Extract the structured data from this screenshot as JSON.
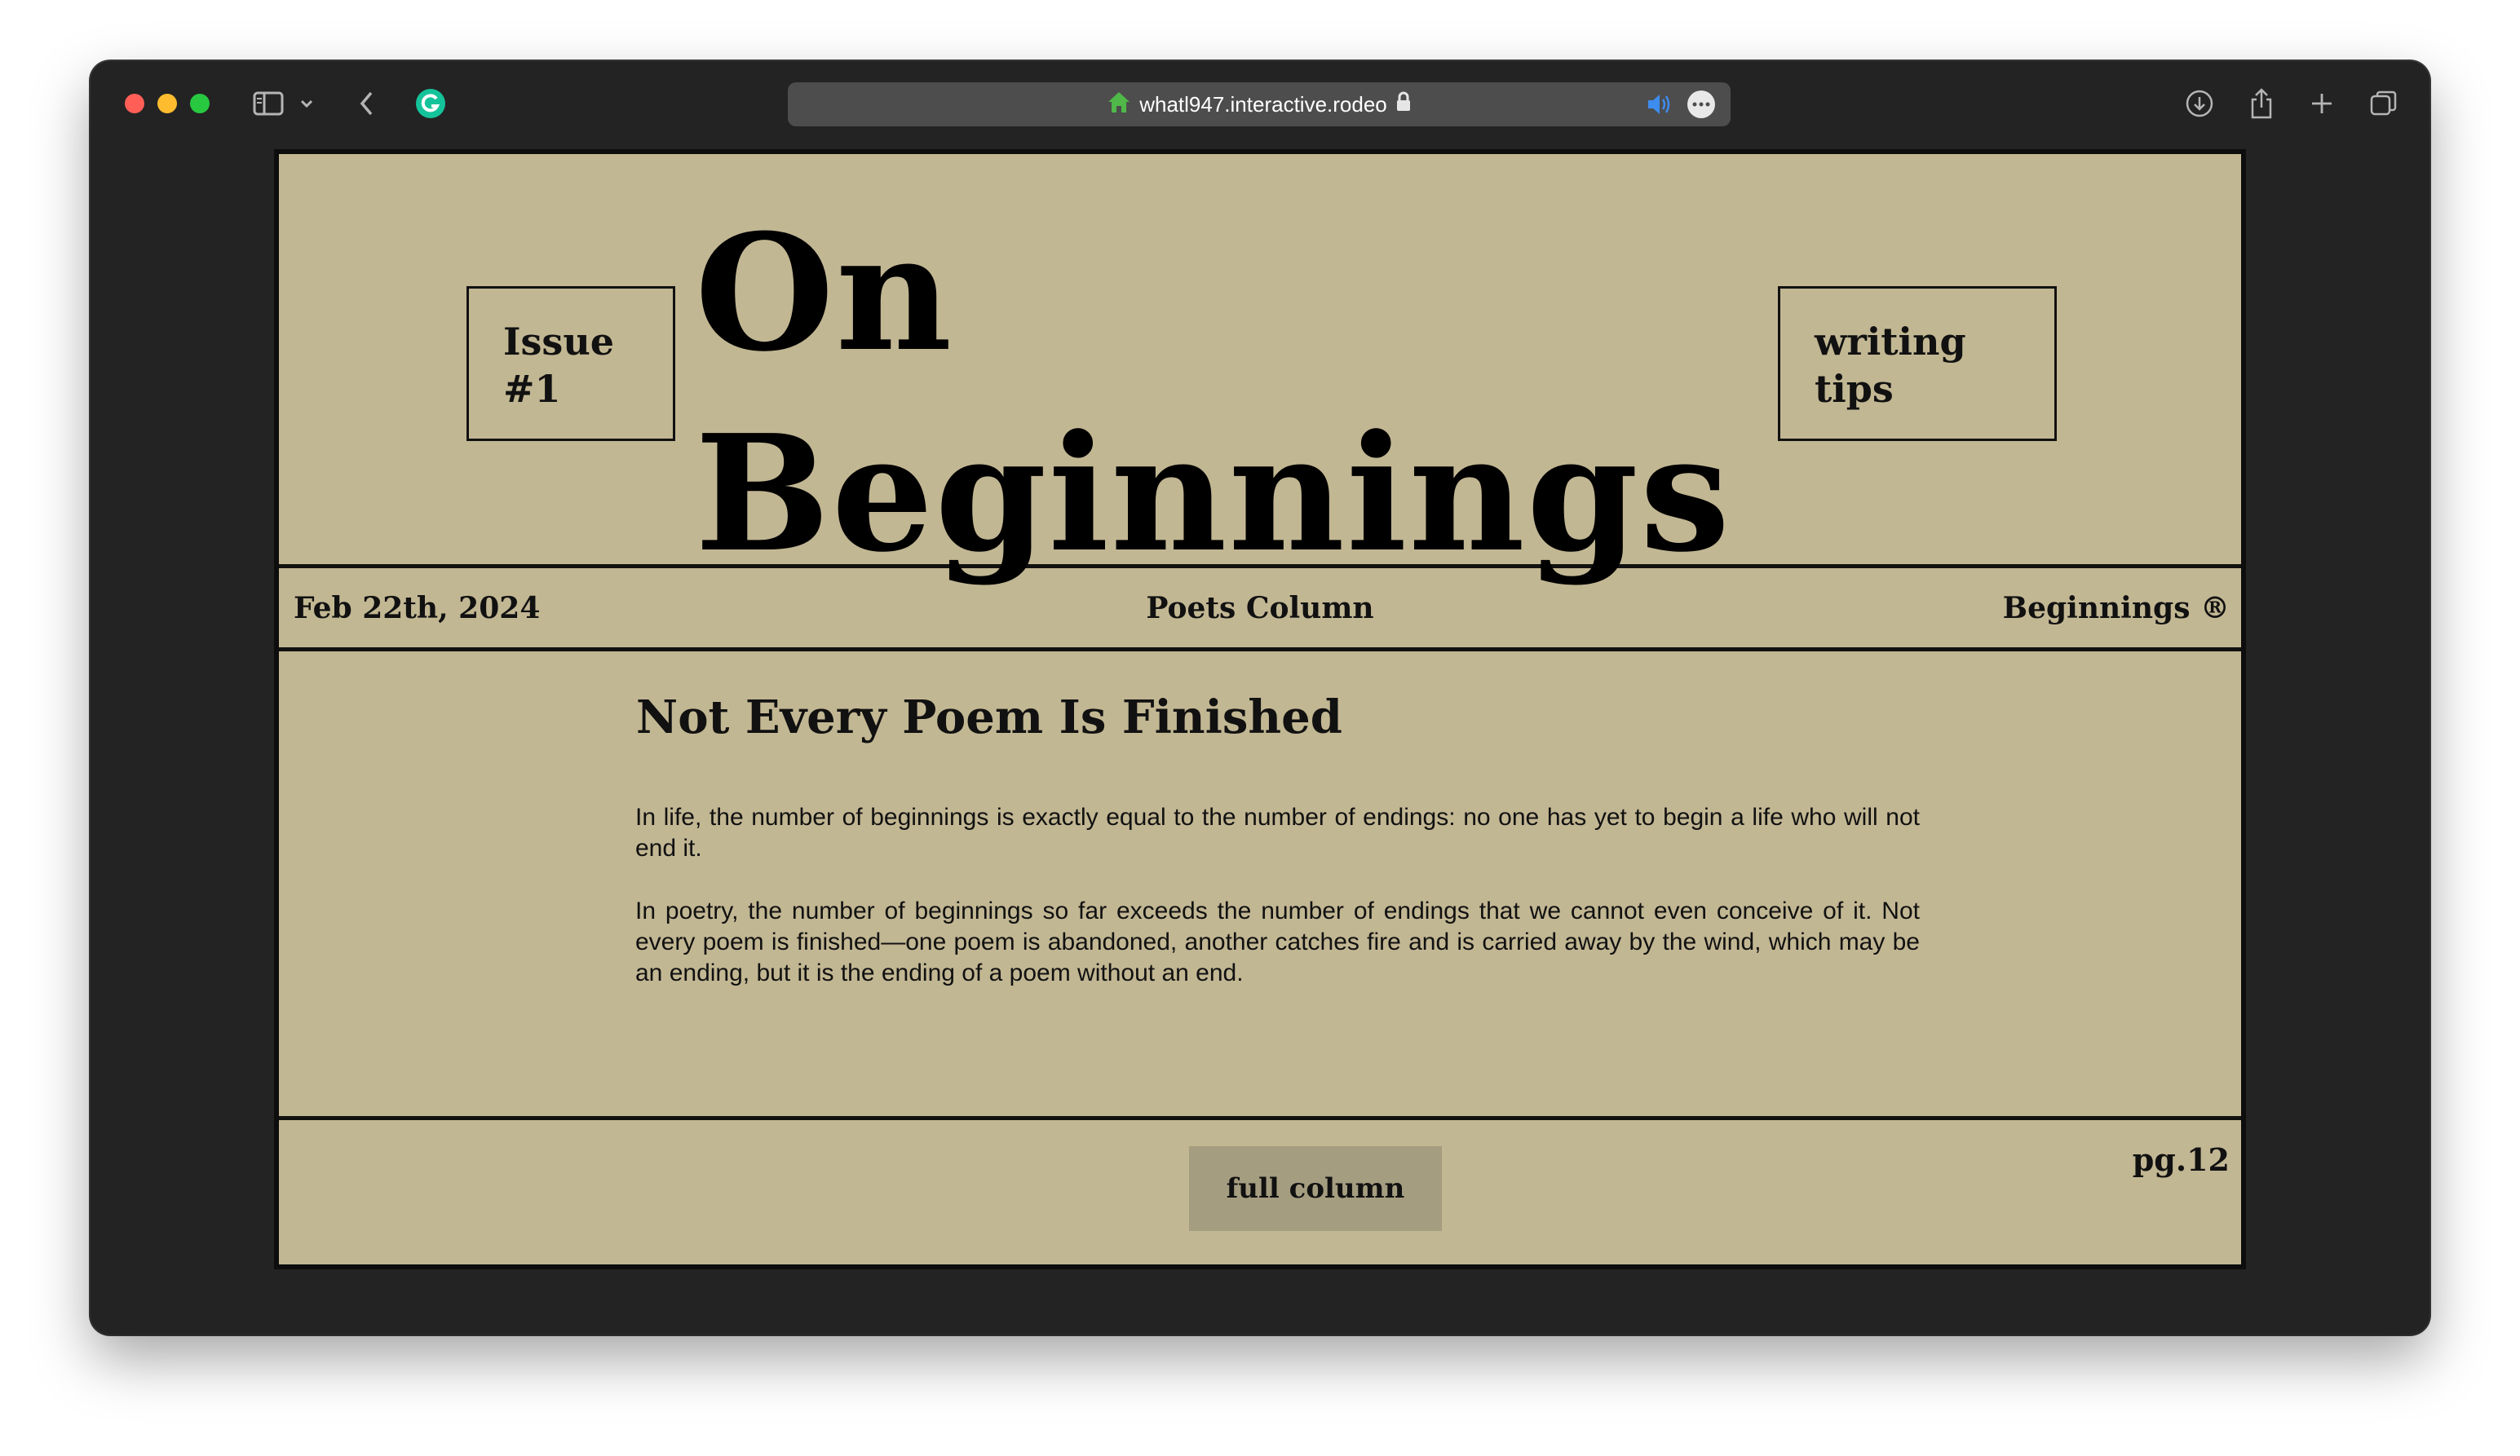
{
  "browser": {
    "url": "whatl947.interactive.rodeo",
    "icons": {
      "sidebar": "sidebar-icon",
      "back": "chevron-left-icon",
      "extension": "grammarly-icon",
      "site": "home-icon",
      "lock": "lock-icon",
      "audio": "speaker-icon",
      "more": "ellipsis-icon",
      "download": "download-icon",
      "share": "share-icon",
      "new_tab": "plus-icon",
      "tabs": "tabs-overview-icon"
    }
  },
  "masthead": {
    "issue_line1": "Issue",
    "issue_line2": "#1",
    "title_line1": "On",
    "title_line2": "Beginnings",
    "tips_line1": "writing",
    "tips_line2": "tips"
  },
  "dateline": {
    "date": "Feb 22th, 2024",
    "section": "Poets Column",
    "brand": "Beginnings ®"
  },
  "article": {
    "title": "Not Every Poem Is Finished",
    "paragraphs": [
      "In life, the number of beginnings is exactly equal to the number of endings: no one has yet to begin a life who will not end it.",
      "In poetry, the number of beginnings so far exceeds the number of endings that we cannot even conceive of it. Not every poem is finished—one poem is abandoned, another catches fire and is carried away by the wind, which may be an ending, but it is the ending of a poem without an end."
    ]
  },
  "footer": {
    "button_label": "full column",
    "page_number": "pg.12"
  },
  "colors": {
    "paper": "#c2b793",
    "button": "#a59d80",
    "ink": "#111111",
    "chrome": "#232323"
  }
}
